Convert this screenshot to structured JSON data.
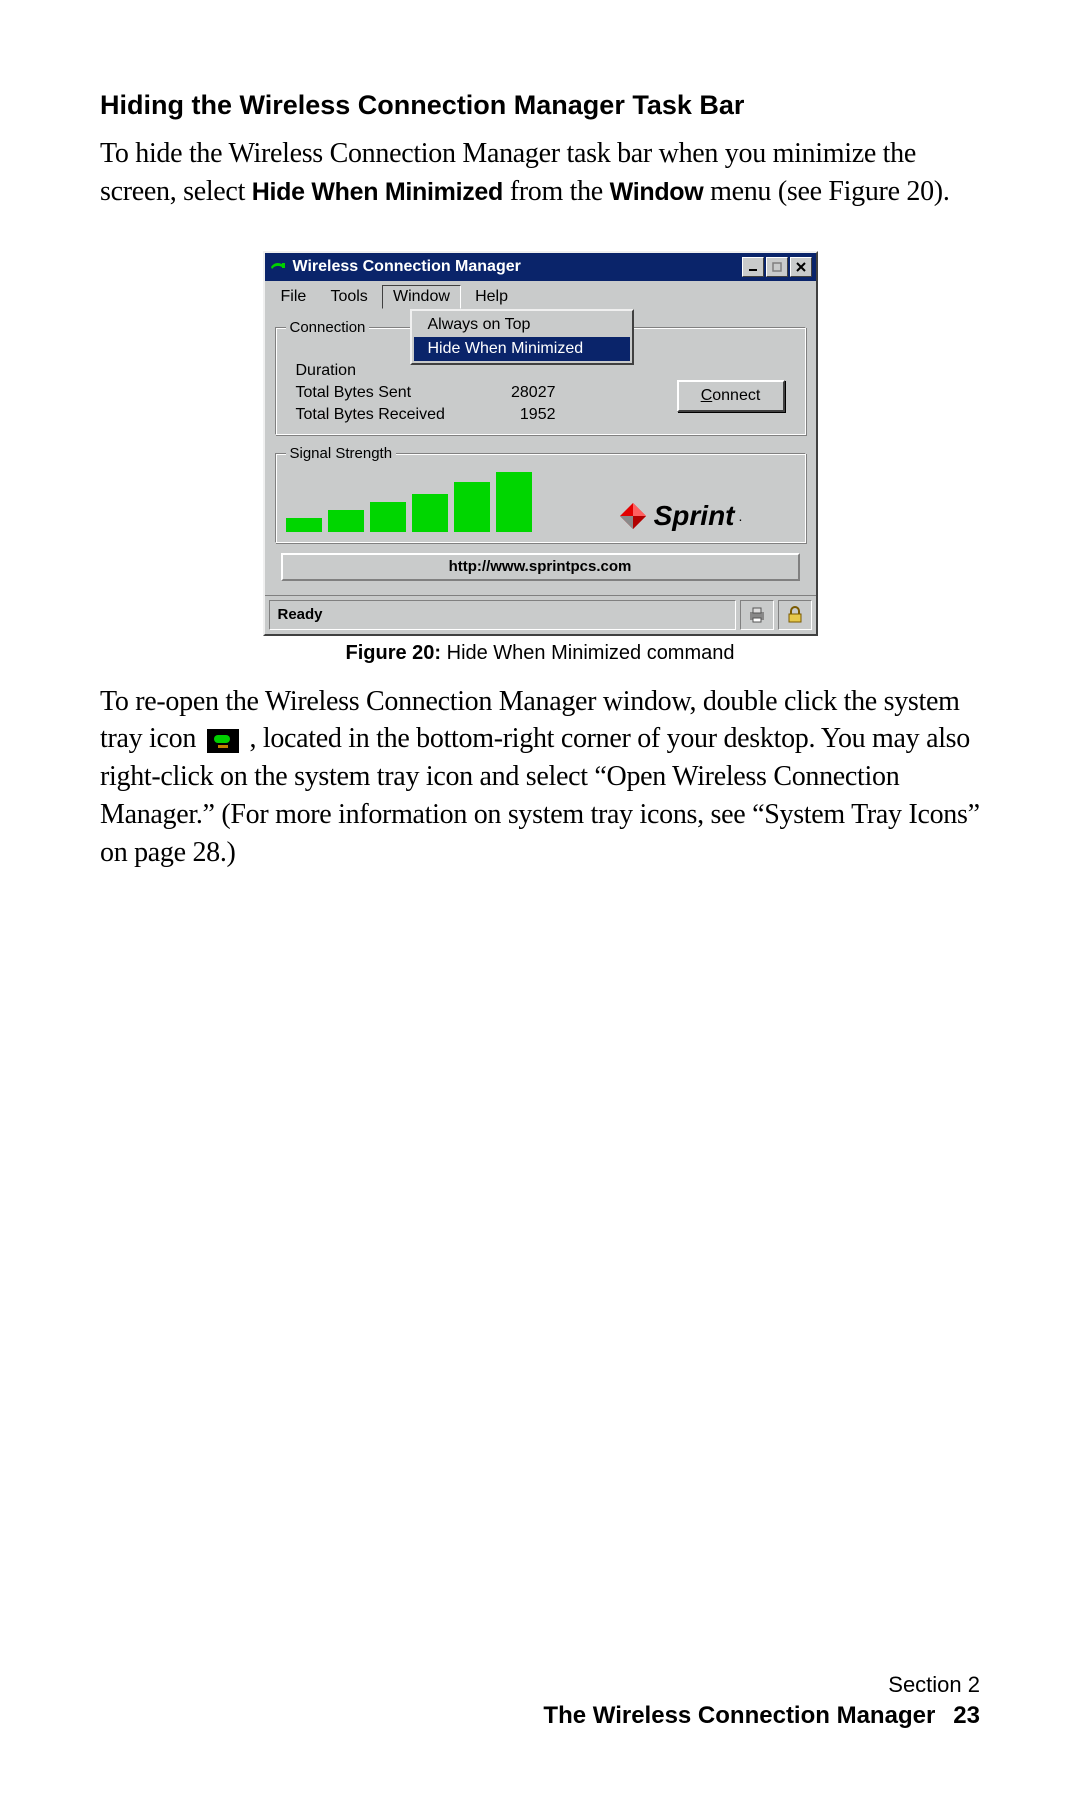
{
  "heading": "Hiding the Wireless Connection Manager Task Bar",
  "para1_a": "To hide the Wireless Connection Manager task bar when you minimize the screen, select ",
  "para1_b1": "Hide When Minimized",
  "para1_c": " from the ",
  "para1_b2": "Window",
  "para1_d": " menu (see Figure 20).",
  "caption_b": "Figure 20:",
  "caption_t": " Hide When Minimized command",
  "para2_a": "To re-open the Wireless Connection Manager window, double click the system tray icon ",
  "para2_b": " , located in the bottom-right corner of your desktop. You may also right-click on the system tray icon and select “Open Wireless Connection Manager.”  (For more information on system tray icons, see “System Tray Icons” on page 28.)",
  "footer": {
    "section": "Section 2",
    "chapter": "The Wireless Connection Manager",
    "page": "23"
  },
  "win": {
    "title": "Wireless Connection Manager",
    "menu": {
      "file": "File",
      "tools": "Tools",
      "window": "Window",
      "help": "Help"
    },
    "dropdown": {
      "always_on_top": "Always on Top",
      "hide_when_min": "Hide When Minimized"
    },
    "group_conn": "Connection",
    "stats": {
      "duration_l": "Duration",
      "sent_l": "Total Bytes Sent",
      "sent_v": "28027",
      "recv_l": "Total Bytes Received",
      "recv_v": "1952"
    },
    "connect_pre": "C",
    "connect_rest": "onnect",
    "group_signal": "Signal Strength",
    "sprint": "Sprint",
    "url": "http://www.sprintpcs.com",
    "status": "Ready"
  },
  "chart_data": {
    "type": "bar",
    "title": "Signal Strength",
    "categories": [
      "1",
      "2",
      "3",
      "4",
      "5",
      "6"
    ],
    "values": [
      14,
      22,
      30,
      38,
      50,
      60
    ],
    "ylim": [
      0,
      60
    ]
  }
}
